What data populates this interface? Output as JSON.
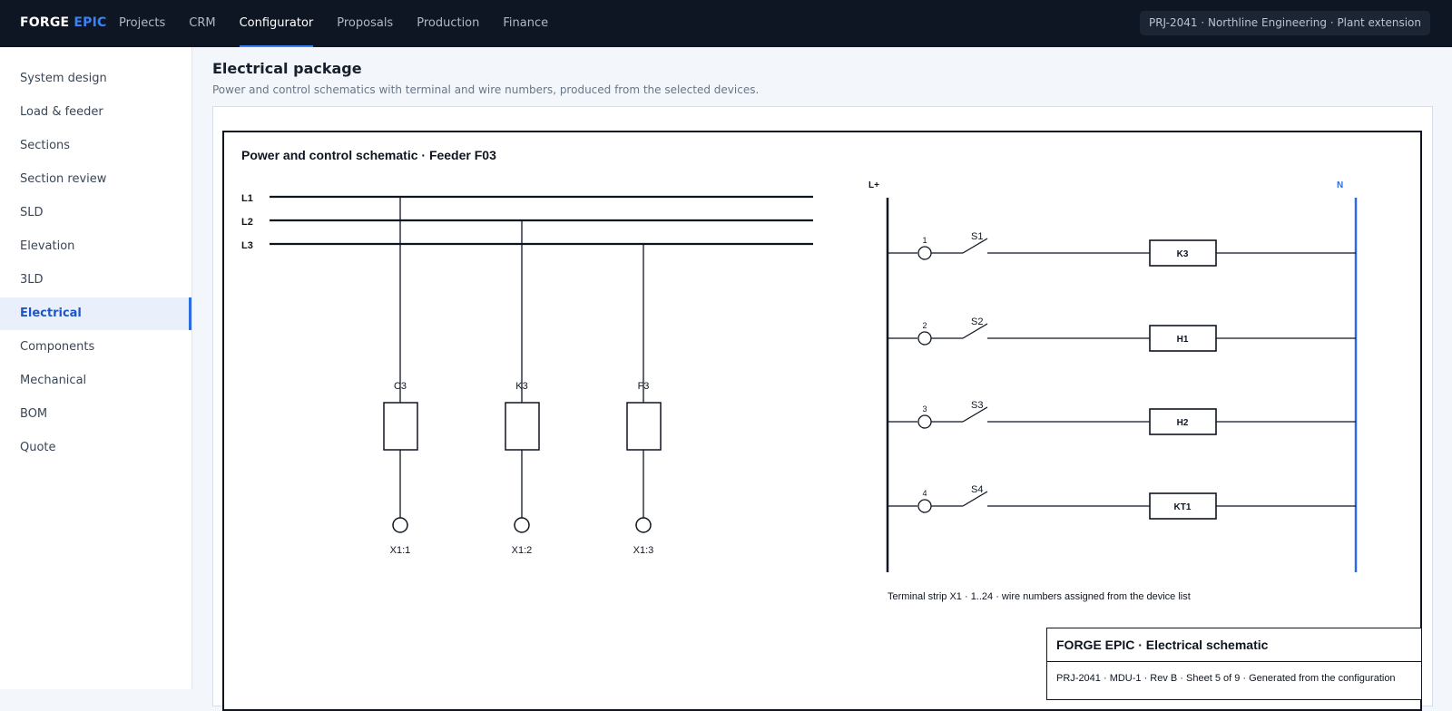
{
  "app": {
    "logo_part1": "FORGE",
    "logo_part2": "EPIC",
    "project_chip": "PRJ-2041 · Northline Engineering · Plant extension"
  },
  "nav": {
    "items": [
      "Projects",
      "CRM",
      "Configurator",
      "Proposals",
      "Production",
      "Finance"
    ],
    "active": "Configurator"
  },
  "sidebar": {
    "items": [
      "System design",
      "Load & feeder",
      "Sections",
      "Section review",
      "SLD",
      "Elevation",
      "3LD",
      "Electrical",
      "Components",
      "Mechanical",
      "BOM",
      "Quote"
    ],
    "active": "Electrical"
  },
  "page": {
    "title": "Electrical package",
    "subtitle": "Power and control schematics with terminal and wire numbers, produced from the selected devices."
  },
  "schematic": {
    "title": "Power and control schematic · Feeder F03",
    "power": {
      "busbars": [
        "L1",
        "L2",
        "L3"
      ],
      "branches": [
        {
          "device": "C3",
          "terminal": "X1:1"
        },
        {
          "device": "K3",
          "terminal": "X1:2"
        },
        {
          "device": "F3",
          "terminal": "X1:3"
        }
      ]
    },
    "control": {
      "left_rail": "L+",
      "right_rail": "N",
      "rungs": [
        {
          "wire": "1",
          "switch": "S1",
          "device": "K3"
        },
        {
          "wire": "2",
          "switch": "S2",
          "device": "H1"
        },
        {
          "wire": "3",
          "switch": "S3",
          "device": "H2"
        },
        {
          "wire": "4",
          "switch": "S4",
          "device": "KT1"
        }
      ],
      "note": "Terminal strip X1 · 1..24 · wire numbers assigned from the device list"
    },
    "title_block": {
      "title": "FORGE EPIC · Electrical schematic",
      "meta": "PRJ-2041 · MDU-1 · Rev B · Sheet 5 of 9 · Generated from the configuration"
    }
  },
  "colors": {
    "topbar": "#0f1623",
    "accent": "#3b82f6",
    "neutral_rail": "#2f6be0",
    "ink": "#0f1520"
  }
}
